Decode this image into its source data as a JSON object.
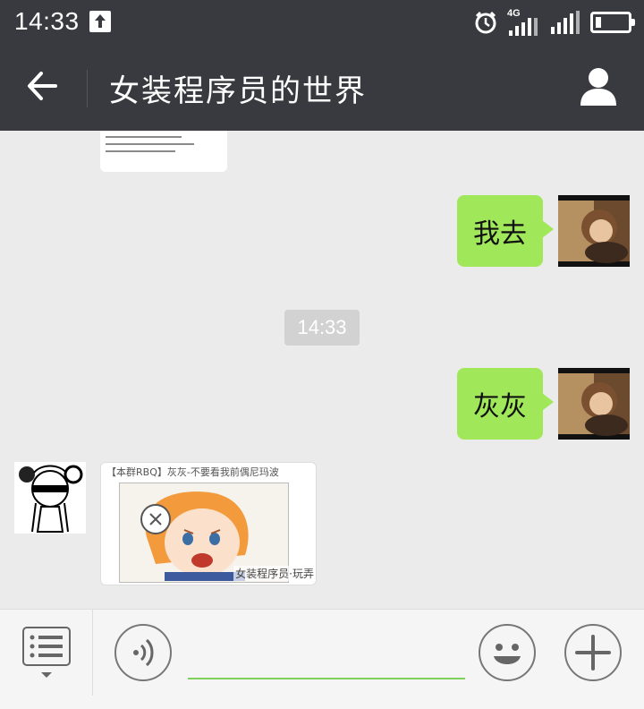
{
  "status_bar": {
    "time": "14:33",
    "network": "4G",
    "icons": [
      "upload-icon",
      "alarm-icon",
      "signal-icon",
      "battery-icon"
    ]
  },
  "header": {
    "title": "女装程序员的世界",
    "back_icon": "arrow-left-icon",
    "profile_icon": "person-icon"
  },
  "chat": {
    "messages": [
      {
        "type": "image-partial",
        "sender": "other"
      },
      {
        "type": "text",
        "sender": "me",
        "text": "我去"
      },
      {
        "type": "timestamp",
        "text": "14:33"
      },
      {
        "type": "text",
        "sender": "me",
        "text": "灰灰"
      },
      {
        "type": "sticker",
        "sender": "other",
        "caption": "【本群RBQ】灰灰-不要看我前偶尼玛波",
        "watermark": "女装程序员·玩弄"
      }
    ]
  },
  "input_bar": {
    "menu_icon": "list-menu-icon",
    "voice_icon": "voice-icon",
    "emoji_icon": "smiley-icon",
    "plus_icon": "plus-icon",
    "input_value": ""
  },
  "colors": {
    "header_bg": "#393a3f",
    "bubble_out": "#a0e759",
    "chat_bg": "#ebebeb",
    "input_underline": "#7ed15a"
  }
}
